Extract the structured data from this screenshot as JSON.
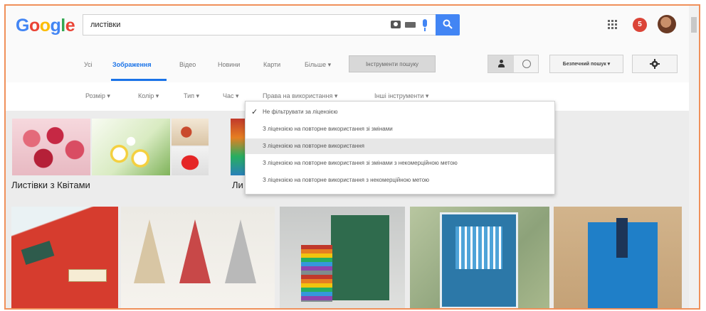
{
  "logo": {
    "letters": [
      "G",
      "o",
      "o",
      "g",
      "l",
      "e"
    ]
  },
  "search": {
    "value": "листівки"
  },
  "header": {
    "notifications": "5"
  },
  "nav": {
    "tabs": [
      "Усі",
      "Зображення",
      "Відео",
      "Новини",
      "Карти",
      "Більше ▾"
    ],
    "tools": "Інструменти пошуку",
    "safe_search": "Безпечний пошук ▾"
  },
  "toolbar": {
    "items": [
      "Розмір ▾",
      "Колір ▾",
      "Тип ▾",
      "Час ▾",
      "Права на використання ▾",
      "Інші інструменти ▾"
    ]
  },
  "dropdown": {
    "items": [
      "Не фільтрувати за ліцензією",
      "З ліцензією на повторне використання зі змінами",
      "З ліцензією на повторне використання",
      "З ліцензією на повторне використання зі змінами з некомерційною метою",
      "З ліцензією на повторне використання з некомерційною метою"
    ],
    "checked_index": 0,
    "hover_index": 2
  },
  "results": {
    "group1_label": "Листівки з Квітами",
    "group2_label": "Ли"
  },
  "colors": {
    "accent": "#4285f4",
    "notification": "#db4437"
  }
}
